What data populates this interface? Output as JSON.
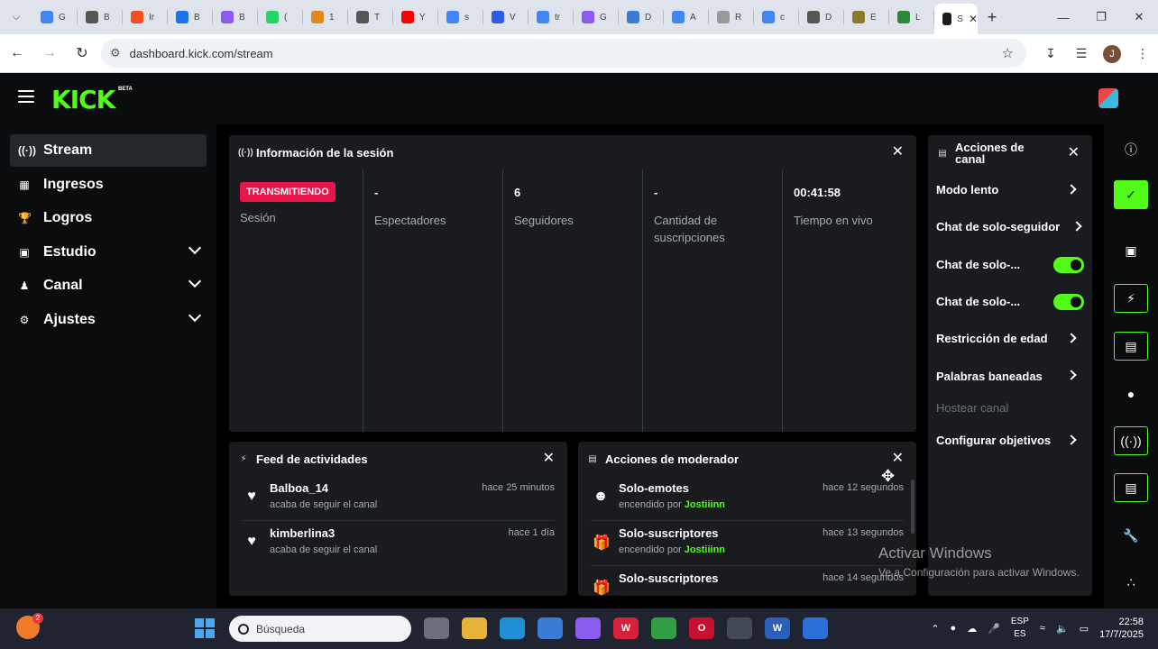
{
  "browser": {
    "tabs": [
      {
        "label": "G",
        "color": "#ffffff"
      },
      {
        "label": "B",
        "color": "#ffffff"
      },
      {
        "label": "Ir",
        "color": "#ffffff"
      },
      {
        "label": "B",
        "color": "#ffffff"
      },
      {
        "label": "B",
        "color": "#ffffff"
      },
      {
        "label": "(",
        "color": "#ffffff"
      },
      {
        "label": "1",
        "color": "#ffffff"
      },
      {
        "label": "T",
        "color": "#ffffff"
      },
      {
        "label": "Y",
        "color": "#ffffff"
      },
      {
        "label": "s",
        "color": "#ffffff"
      },
      {
        "label": "V",
        "color": "#ffffff"
      },
      {
        "label": "tr",
        "color": "#ffffff"
      },
      {
        "label": "G",
        "color": "#ffffff"
      },
      {
        "label": "D",
        "color": "#ffffff"
      },
      {
        "label": "A",
        "color": "#ffffff"
      },
      {
        "label": "R",
        "color": "#ffffff"
      },
      {
        "label": "c",
        "color": "#ffffff"
      },
      {
        "label": "D",
        "color": "#ffffff"
      },
      {
        "label": "E",
        "color": "#ffffff"
      },
      {
        "label": "L",
        "color": "#ffffff"
      }
    ],
    "active_tab": "S",
    "url": "dashboard.kick.com/stream",
    "profile_initial": "J"
  },
  "brand": {
    "logo": "KICK",
    "beta": "BETA",
    "accent": "#53fc18"
  },
  "sidebar": {
    "items": [
      {
        "label": "Stream",
        "icon": "broadcast-icon"
      },
      {
        "label": "Ingresos",
        "icon": "chart-icon"
      },
      {
        "label": "Logros",
        "icon": "trophy-icon"
      },
      {
        "label": "Estudio",
        "icon": "studio-icon"
      },
      {
        "label": "Canal",
        "icon": "people-icon"
      },
      {
        "label": "Ajustes",
        "icon": "gear-icon"
      }
    ]
  },
  "session": {
    "title": "Información de la sesión",
    "badge": "TRANSMITIENDO",
    "stats": [
      {
        "value": "",
        "label": "Sesión"
      },
      {
        "value": "-",
        "label": "Espectadores"
      },
      {
        "value": "6",
        "label": "Seguidores"
      },
      {
        "value": "-",
        "label": "Cantidad de suscripciones"
      },
      {
        "value": "00:41:58",
        "label": "Tiempo en vivo"
      }
    ]
  },
  "channel_actions": {
    "title": "Acciones de canal",
    "items": [
      {
        "label": "Modo lento",
        "kind": "arrow"
      },
      {
        "label": "Chat de solo-seguidor",
        "kind": "arrow"
      },
      {
        "label": "Chat de solo-...",
        "kind": "toggle"
      },
      {
        "label": "Chat de solo-...",
        "kind": "toggle"
      },
      {
        "label": "Restricción de edad",
        "kind": "arrow"
      },
      {
        "label": "Palabras baneadas",
        "kind": "arrow"
      },
      {
        "label": "Hostear canal",
        "kind": "disabled"
      },
      {
        "label": "Configurar objetivos",
        "kind": "arrow"
      }
    ]
  },
  "feed": {
    "title": "Feed de actividades",
    "rows": [
      {
        "name": "Balboa_14",
        "sub": "acaba de seguir el canal",
        "time": "hace 25 minutos"
      },
      {
        "name": "kimberlina3",
        "sub": "acaba de seguir el canal",
        "time": "hace 1 día"
      }
    ]
  },
  "mod": {
    "title": "Acciones de moderador",
    "rows": [
      {
        "name": "Solo-emotes",
        "sub_prefix": "encendido por",
        "user": "Jostiiinn",
        "time": "hace 12 segundos",
        "icon": "emote-icon"
      },
      {
        "name": "Solo-suscriptores",
        "sub_prefix": "encendido por",
        "user": "Jostiiinn",
        "time": "hace 13 segundos",
        "icon": "gift-icon"
      },
      {
        "name": "Solo-suscriptores",
        "sub_prefix": "",
        "user": "",
        "time": "hace 14 segundos",
        "icon": "gift-icon"
      }
    ]
  },
  "watermark": {
    "line1": "Activar Windows",
    "line2": "Ve a Configuración para activar Windows."
  },
  "taskbar": {
    "search_placeholder": "Búsqueda",
    "notification_count": "2",
    "lang_top": "ESP",
    "lang_bottom": "ES",
    "time": "22:58",
    "date": "17/7/2025"
  }
}
